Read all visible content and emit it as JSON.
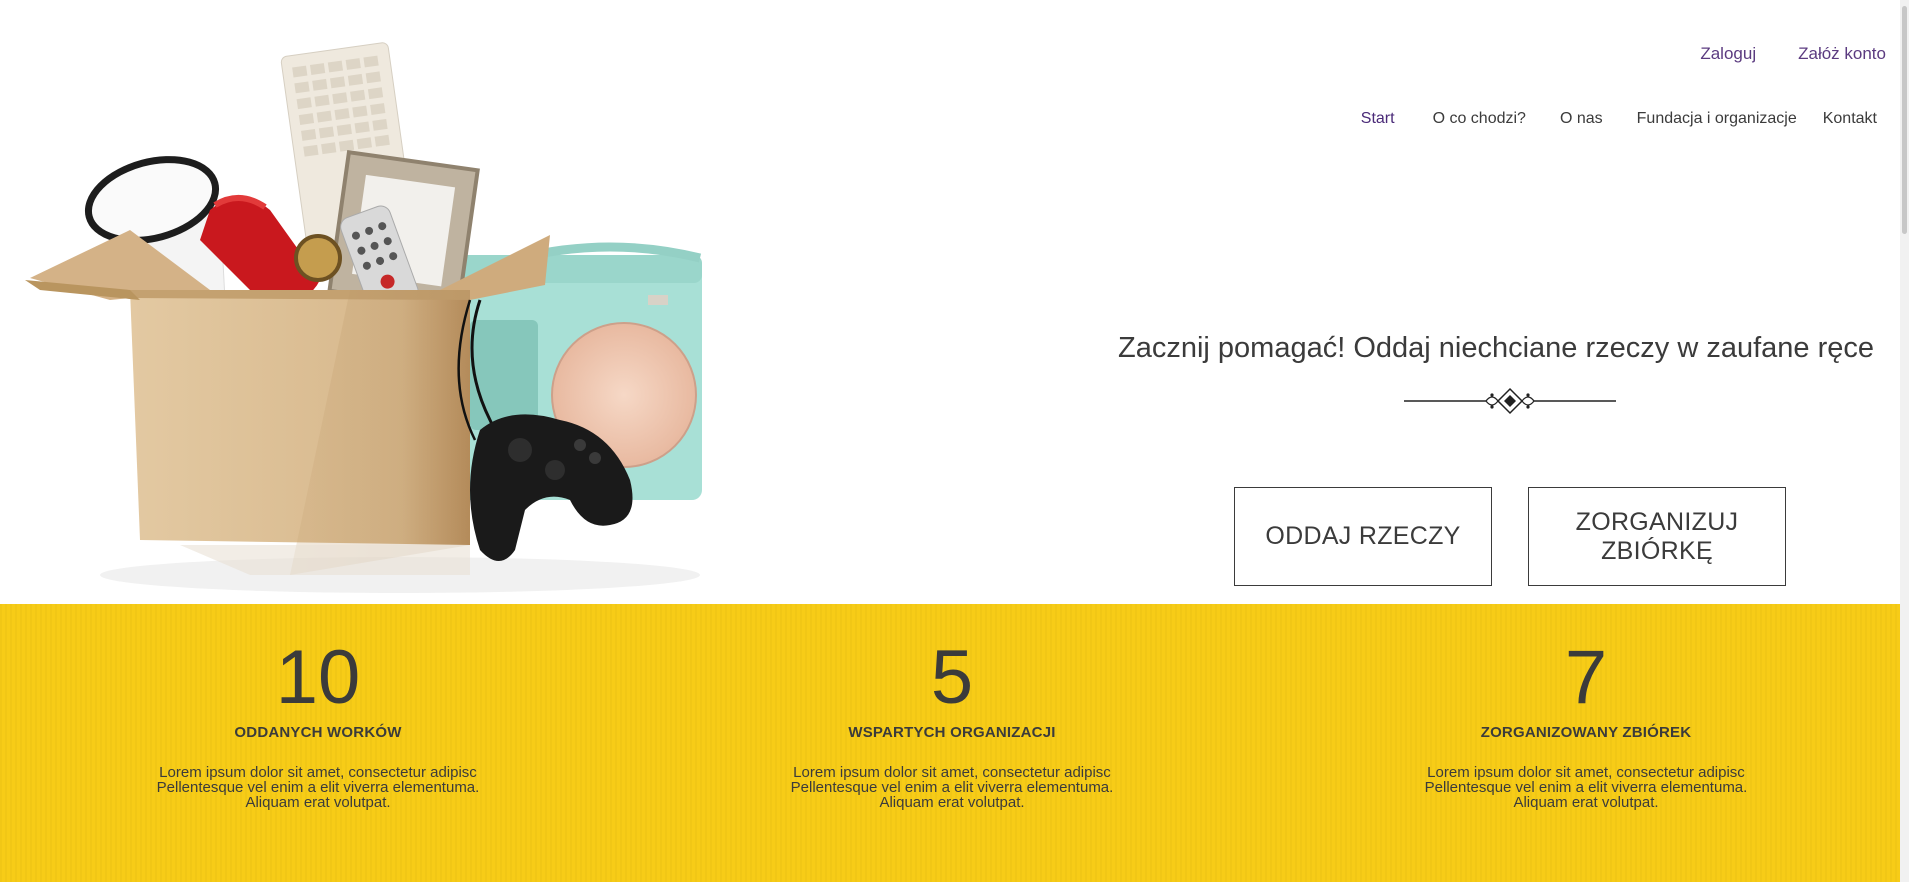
{
  "auth": {
    "login": "Zaloguj",
    "register": "Załóż konto"
  },
  "nav": {
    "items": [
      {
        "label": "Start",
        "active": true
      },
      {
        "label": "O co chodzi?"
      },
      {
        "label": "O nas"
      },
      {
        "label": "Fundacja i organizacje"
      },
      {
        "label": "Kontakt"
      }
    ]
  },
  "hero": {
    "headline": "Zacznij pomagać! Oddaj niechciane rzeczy w zaufane ręce",
    "cta_give": "ODDAJ RZECZY",
    "cta_organize": "ZORGANIZUJ ZBIÓRKĘ"
  },
  "stats": [
    {
      "number": "10",
      "label": "ODDANYCH WORKÓW",
      "desc": [
        "Lorem ipsum dolor sit amet, consectetur adipisc",
        "Pellentesque vel enim a elit viverra elementuma.",
        "Aliquam erat volutpat."
      ]
    },
    {
      "number": "5",
      "label": "WSPARTYCH ORGANIZACJI",
      "desc": [
        "Lorem ipsum dolor sit amet, consectetur adipisc",
        "Pellentesque vel enim a elit viverra elementuma.",
        "Aliquam erat volutpat."
      ]
    },
    {
      "number": "7",
      "label": "ZORGANIZOWANY ZBIÓREK",
      "desc": [
        "Lorem ipsum dolor sit amet, consectetur adipisc",
        "Pellentesque vel enim a elit viverra elementuma.",
        "Aliquam erat volutpat."
      ]
    }
  ],
  "colors": {
    "accent": "#f7cc17",
    "brand": "#5b3b80",
    "text": "#3b3b3b"
  }
}
